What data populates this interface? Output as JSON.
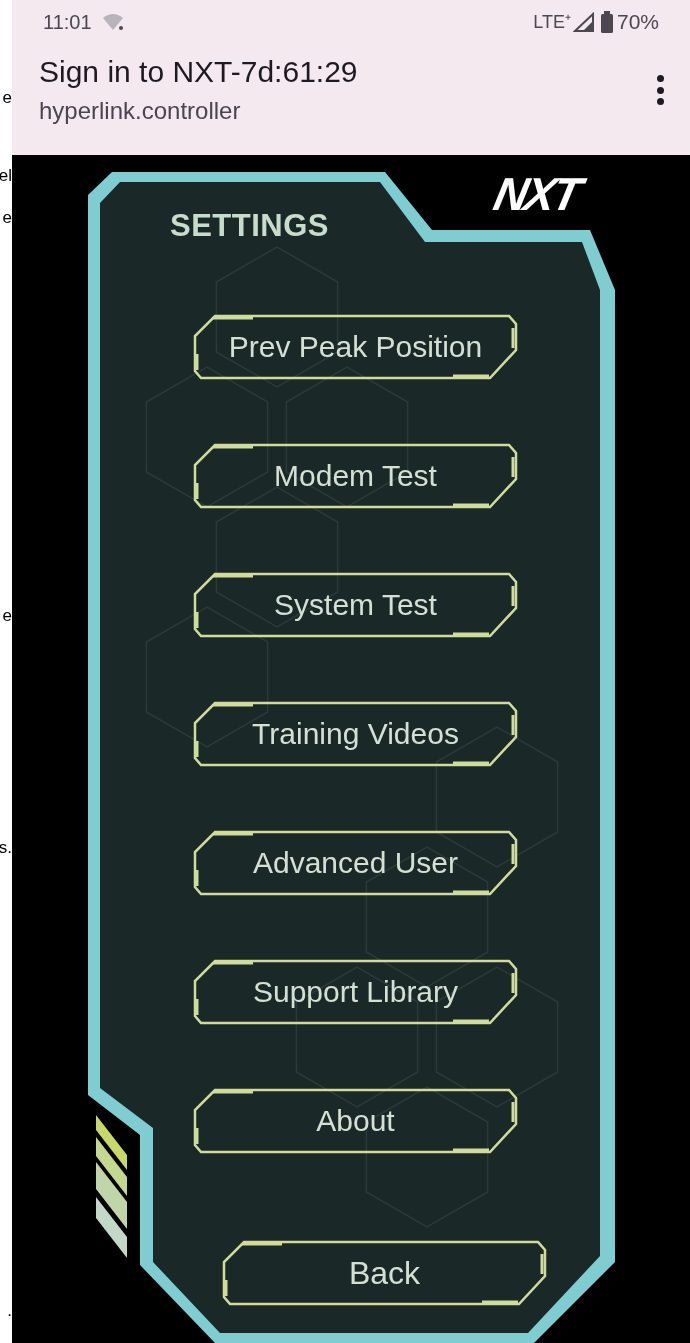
{
  "background_fragments": [
    "e",
    "el",
    "e",
    "e",
    "s.",
    "."
  ],
  "status_bar": {
    "time": "11:01",
    "network": "LTE⁺",
    "battery": "70%"
  },
  "browser_header": {
    "title": "Sign in to NXT-7d:61:29",
    "url": "hyperlink.controller"
  },
  "panel": {
    "title": "SETTINGS",
    "logo": "NXT",
    "buttons": [
      {
        "label": "Prev Peak Position",
        "kind": "menu"
      },
      {
        "label": "Modem Test",
        "kind": "menu"
      },
      {
        "label": "System Test",
        "kind": "menu"
      },
      {
        "label": "Training Videos",
        "kind": "menu"
      },
      {
        "label": "Advanced User",
        "kind": "menu"
      },
      {
        "label": "Support Library",
        "kind": "menu"
      },
      {
        "label": "About",
        "kind": "menu"
      },
      {
        "label": "Back",
        "kind": "back"
      }
    ]
  }
}
